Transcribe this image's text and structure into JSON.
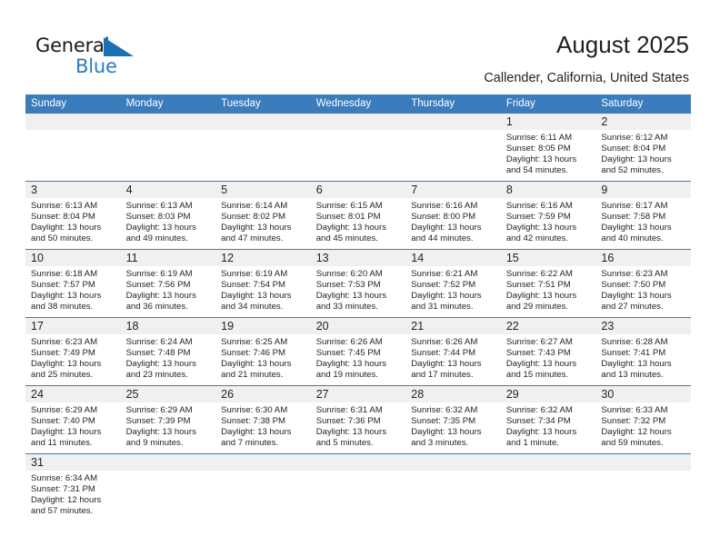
{
  "brand": {
    "name_part1": "General",
    "name_part2": "Blue",
    "flag_icon": "blue-triangle-flag-icon",
    "colors": {
      "dark": "#1a1a1a",
      "blue": "#2b7cc0"
    }
  },
  "header": {
    "title": "August 2025",
    "subtitle": "Callender, California, United States"
  },
  "colors": {
    "header_blue": "#3b7cbd",
    "daynum_bg": "#f0f0f0",
    "text": "#231f20"
  },
  "weekdays": [
    "Sunday",
    "Monday",
    "Tuesday",
    "Wednesday",
    "Thursday",
    "Friday",
    "Saturday"
  ],
  "labels": {
    "sunrise_prefix": "Sunrise: ",
    "sunset_prefix": "Sunset: ",
    "daylight_prefix": "Daylight: "
  },
  "weeks": [
    [
      {
        "day": ""
      },
      {
        "day": ""
      },
      {
        "day": ""
      },
      {
        "day": ""
      },
      {
        "day": ""
      },
      {
        "day": "1",
        "sunrise": "Sunrise: 6:11 AM",
        "sunset": "Sunset: 8:05 PM",
        "daylight_line1": "Daylight: 13 hours",
        "daylight_line2": "and 54 minutes."
      },
      {
        "day": "2",
        "sunrise": "Sunrise: 6:12 AM",
        "sunset": "Sunset: 8:04 PM",
        "daylight_line1": "Daylight: 13 hours",
        "daylight_line2": "and 52 minutes."
      }
    ],
    [
      {
        "day": "3",
        "sunrise": "Sunrise: 6:13 AM",
        "sunset": "Sunset: 8:04 PM",
        "daylight_line1": "Daylight: 13 hours",
        "daylight_line2": "and 50 minutes."
      },
      {
        "day": "4",
        "sunrise": "Sunrise: 6:13 AM",
        "sunset": "Sunset: 8:03 PM",
        "daylight_line1": "Daylight: 13 hours",
        "daylight_line2": "and 49 minutes."
      },
      {
        "day": "5",
        "sunrise": "Sunrise: 6:14 AM",
        "sunset": "Sunset: 8:02 PM",
        "daylight_line1": "Daylight: 13 hours",
        "daylight_line2": "and 47 minutes."
      },
      {
        "day": "6",
        "sunrise": "Sunrise: 6:15 AM",
        "sunset": "Sunset: 8:01 PM",
        "daylight_line1": "Daylight: 13 hours",
        "daylight_line2": "and 45 minutes."
      },
      {
        "day": "7",
        "sunrise": "Sunrise: 6:16 AM",
        "sunset": "Sunset: 8:00 PM",
        "daylight_line1": "Daylight: 13 hours",
        "daylight_line2": "and 44 minutes."
      },
      {
        "day": "8",
        "sunrise": "Sunrise: 6:16 AM",
        "sunset": "Sunset: 7:59 PM",
        "daylight_line1": "Daylight: 13 hours",
        "daylight_line2": "and 42 minutes."
      },
      {
        "day": "9",
        "sunrise": "Sunrise: 6:17 AM",
        "sunset": "Sunset: 7:58 PM",
        "daylight_line1": "Daylight: 13 hours",
        "daylight_line2": "and 40 minutes."
      }
    ],
    [
      {
        "day": "10",
        "sunrise": "Sunrise: 6:18 AM",
        "sunset": "Sunset: 7:57 PM",
        "daylight_line1": "Daylight: 13 hours",
        "daylight_line2": "and 38 minutes."
      },
      {
        "day": "11",
        "sunrise": "Sunrise: 6:19 AM",
        "sunset": "Sunset: 7:56 PM",
        "daylight_line1": "Daylight: 13 hours",
        "daylight_line2": "and 36 minutes."
      },
      {
        "day": "12",
        "sunrise": "Sunrise: 6:19 AM",
        "sunset": "Sunset: 7:54 PM",
        "daylight_line1": "Daylight: 13 hours",
        "daylight_line2": "and 34 minutes."
      },
      {
        "day": "13",
        "sunrise": "Sunrise: 6:20 AM",
        "sunset": "Sunset: 7:53 PM",
        "daylight_line1": "Daylight: 13 hours",
        "daylight_line2": "and 33 minutes."
      },
      {
        "day": "14",
        "sunrise": "Sunrise: 6:21 AM",
        "sunset": "Sunset: 7:52 PM",
        "daylight_line1": "Daylight: 13 hours",
        "daylight_line2": "and 31 minutes."
      },
      {
        "day": "15",
        "sunrise": "Sunrise: 6:22 AM",
        "sunset": "Sunset: 7:51 PM",
        "daylight_line1": "Daylight: 13 hours",
        "daylight_line2": "and 29 minutes."
      },
      {
        "day": "16",
        "sunrise": "Sunrise: 6:23 AM",
        "sunset": "Sunset: 7:50 PM",
        "daylight_line1": "Daylight: 13 hours",
        "daylight_line2": "and 27 minutes."
      }
    ],
    [
      {
        "day": "17",
        "sunrise": "Sunrise: 6:23 AM",
        "sunset": "Sunset: 7:49 PM",
        "daylight_line1": "Daylight: 13 hours",
        "daylight_line2": "and 25 minutes."
      },
      {
        "day": "18",
        "sunrise": "Sunrise: 6:24 AM",
        "sunset": "Sunset: 7:48 PM",
        "daylight_line1": "Daylight: 13 hours",
        "daylight_line2": "and 23 minutes."
      },
      {
        "day": "19",
        "sunrise": "Sunrise: 6:25 AM",
        "sunset": "Sunset: 7:46 PM",
        "daylight_line1": "Daylight: 13 hours",
        "daylight_line2": "and 21 minutes."
      },
      {
        "day": "20",
        "sunrise": "Sunrise: 6:26 AM",
        "sunset": "Sunset: 7:45 PM",
        "daylight_line1": "Daylight: 13 hours",
        "daylight_line2": "and 19 minutes."
      },
      {
        "day": "21",
        "sunrise": "Sunrise: 6:26 AM",
        "sunset": "Sunset: 7:44 PM",
        "daylight_line1": "Daylight: 13 hours",
        "daylight_line2": "and 17 minutes."
      },
      {
        "day": "22",
        "sunrise": "Sunrise: 6:27 AM",
        "sunset": "Sunset: 7:43 PM",
        "daylight_line1": "Daylight: 13 hours",
        "daylight_line2": "and 15 minutes."
      },
      {
        "day": "23",
        "sunrise": "Sunrise: 6:28 AM",
        "sunset": "Sunset: 7:41 PM",
        "daylight_line1": "Daylight: 13 hours",
        "daylight_line2": "and 13 minutes."
      }
    ],
    [
      {
        "day": "24",
        "sunrise": "Sunrise: 6:29 AM",
        "sunset": "Sunset: 7:40 PM",
        "daylight_line1": "Daylight: 13 hours",
        "daylight_line2": "and 11 minutes."
      },
      {
        "day": "25",
        "sunrise": "Sunrise: 6:29 AM",
        "sunset": "Sunset: 7:39 PM",
        "daylight_line1": "Daylight: 13 hours",
        "daylight_line2": "and 9 minutes."
      },
      {
        "day": "26",
        "sunrise": "Sunrise: 6:30 AM",
        "sunset": "Sunset: 7:38 PM",
        "daylight_line1": "Daylight: 13 hours",
        "daylight_line2": "and 7 minutes."
      },
      {
        "day": "27",
        "sunrise": "Sunrise: 6:31 AM",
        "sunset": "Sunset: 7:36 PM",
        "daylight_line1": "Daylight: 13 hours",
        "daylight_line2": "and 5 minutes."
      },
      {
        "day": "28",
        "sunrise": "Sunrise: 6:32 AM",
        "sunset": "Sunset: 7:35 PM",
        "daylight_line1": "Daylight: 13 hours",
        "daylight_line2": "and 3 minutes."
      },
      {
        "day": "29",
        "sunrise": "Sunrise: 6:32 AM",
        "sunset": "Sunset: 7:34 PM",
        "daylight_line1": "Daylight: 13 hours",
        "daylight_line2": "and 1 minute."
      },
      {
        "day": "30",
        "sunrise": "Sunrise: 6:33 AM",
        "sunset": "Sunset: 7:32 PM",
        "daylight_line1": "Daylight: 12 hours",
        "daylight_line2": "and 59 minutes."
      }
    ],
    [
      {
        "day": "31",
        "sunrise": "Sunrise: 6:34 AM",
        "sunset": "Sunset: 7:31 PM",
        "daylight_line1": "Daylight: 12 hours",
        "daylight_line2": "and 57 minutes."
      },
      {
        "day": ""
      },
      {
        "day": ""
      },
      {
        "day": ""
      },
      {
        "day": ""
      },
      {
        "day": ""
      },
      {
        "day": ""
      }
    ]
  ]
}
